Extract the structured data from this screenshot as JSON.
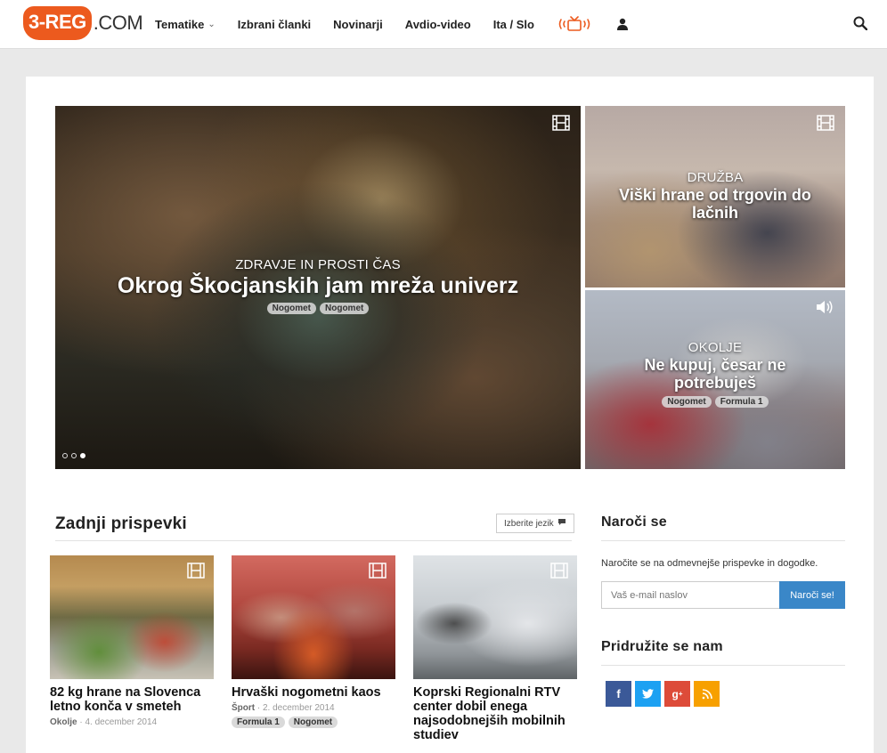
{
  "brand": {
    "logo_badge": "3-REG",
    "logo_rest": ".COM"
  },
  "nav": {
    "items": [
      {
        "label": "Tematike",
        "has_dropdown": true
      },
      {
        "label": "Izbrani članki"
      },
      {
        "label": "Novinarji"
      },
      {
        "label": "Avdio-video"
      },
      {
        "label": "Ita / Slo"
      }
    ],
    "icons": [
      "tv-broadcast-icon",
      "user-icon",
      "search-icon"
    ],
    "accent_color": "#ec5a1e"
  },
  "hero": {
    "main": {
      "category": "ZDRAVJE IN PROSTI ČAS",
      "title": "Okrog Škocjanskih jam mreža univerz",
      "tags": [
        "Nogomet",
        "Nogomet"
      ],
      "icon": "film-icon",
      "slider_dots": 3,
      "active_dot": 3
    },
    "side_top": {
      "category": "DRUŽBA",
      "title": "Viški hrane od trgovin do lačnih",
      "icon": "film-icon"
    },
    "side_bottom": {
      "category": "OKOLJE",
      "title": "Ne kupuj, česar ne potrebuješ",
      "tags": [
        "Nogomet",
        "Formula 1"
      ],
      "icon": "audio-icon"
    }
  },
  "latest": {
    "title": "Zadnji prispevki",
    "language_button": "Izberite jezik",
    "posts": [
      {
        "title": "82 kg hrane na Slovenca letno konča v smeteh",
        "category": "Okolje",
        "date": "4. december 2014",
        "tags": [],
        "icon": "film-icon"
      },
      {
        "title": "Hrvaški nogometni kaos",
        "category": "Šport",
        "date": "2. december 2014",
        "tags": [
          "Formula 1",
          "Nogomet"
        ],
        "icon": "film-icon"
      },
      {
        "title": "Koprski Regionalni RTV center dobil enega najsodobnejših mobilnih studiev",
        "category": "",
        "date": "",
        "tags": [],
        "icon": "film-icon"
      }
    ]
  },
  "sidebar": {
    "subscribe": {
      "title": "Naroči se",
      "text": "Naročite se na odmevnejše prispevke in dogodke.",
      "email_placeholder": "Vaš e-mail naslov",
      "button": "Naroči se!",
      "button_color": "#3a87c8"
    },
    "join": {
      "title": "Pridružite se nam",
      "networks": [
        {
          "name": "facebook-icon",
          "glyph": "f",
          "color": "#3b5998"
        },
        {
          "name": "twitter-icon",
          "glyph": "🐦",
          "color": "#1da1f2"
        },
        {
          "name": "google-plus-icon",
          "glyph": "g⁺",
          "color": "#dd4b39"
        },
        {
          "name": "rss-icon",
          "glyph": "◔",
          "color": "#f7a000"
        }
      ]
    }
  }
}
